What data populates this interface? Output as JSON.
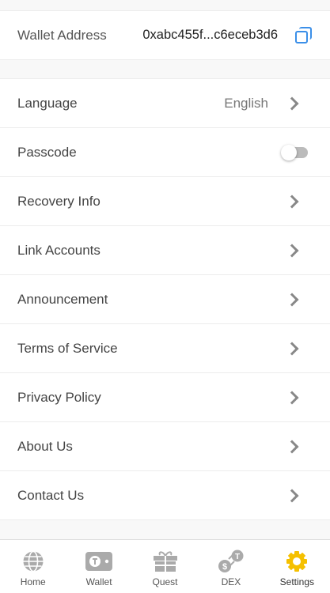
{
  "wallet": {
    "label": "Wallet Address",
    "address": "0xabc455f...c6eceb3d6"
  },
  "menu": [
    {
      "label": "Language",
      "value": "English",
      "type": "chevron"
    },
    {
      "label": "Passcode",
      "type": "toggle",
      "enabled": false
    },
    {
      "label": "Recovery Info",
      "type": "chevron"
    },
    {
      "label": "Link Accounts",
      "type": "chevron"
    },
    {
      "label": "Announcement",
      "type": "chevron"
    },
    {
      "label": "Terms of Service",
      "type": "chevron"
    },
    {
      "label": "Privacy Policy",
      "type": "chevron"
    },
    {
      "label": "About Us",
      "type": "chevron"
    },
    {
      "label": "Contact Us",
      "type": "chevron"
    }
  ],
  "tabs": [
    {
      "label": "Home",
      "icon": "globe-icon"
    },
    {
      "label": "Wallet",
      "icon": "wallet-icon"
    },
    {
      "label": "Quest",
      "icon": "gift-icon"
    },
    {
      "label": "DEX",
      "icon": "exchange-icon"
    },
    {
      "label": "Settings",
      "icon": "gear-icon",
      "active": true
    }
  ],
  "colors": {
    "accent": "#f5c000",
    "copy": "#3b8fe8",
    "inactive": "#aaaaaa"
  }
}
